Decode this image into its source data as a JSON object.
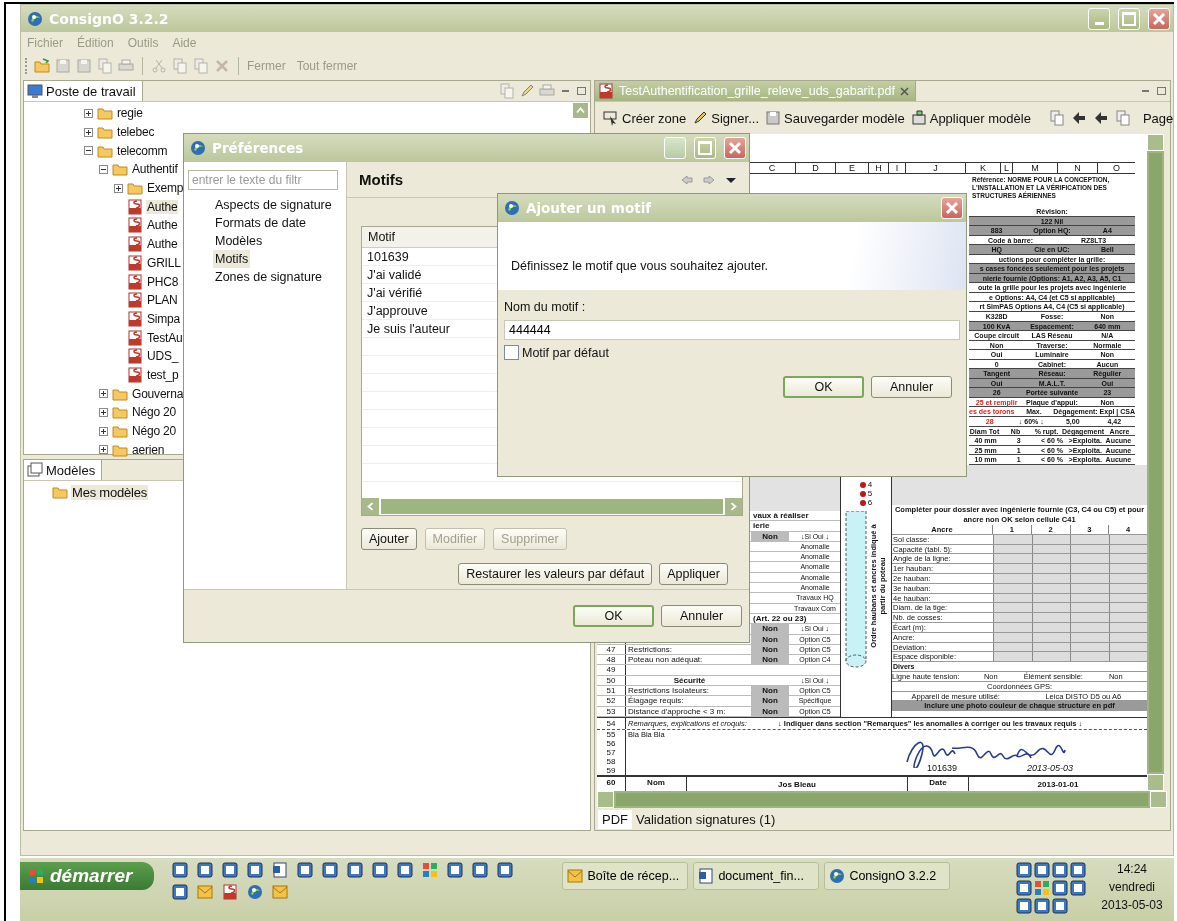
{
  "window": {
    "title": "ConsignO 3.2.2"
  },
  "menu": [
    {
      "label": "Fichier",
      "disabled": true
    },
    {
      "label": "Édition",
      "disabled": true
    },
    {
      "label": "Outils",
      "disabled": true
    },
    {
      "label": "Aide",
      "disabled": true
    }
  ],
  "toolbar": {
    "text_buttons": [
      {
        "label": "Fermer",
        "disabled": true
      },
      {
        "label": "Tout fermer",
        "disabled": true
      }
    ]
  },
  "workspace": {
    "tab": "Poste de travail",
    "tree": [
      {
        "label": "regie",
        "kind": "folder",
        "expanded": false,
        "selected": false
      },
      {
        "label": "telebec",
        "kind": "folder",
        "expanded": false,
        "selected": false
      },
      {
        "label": "telecomm",
        "kind": "folder",
        "expanded": true,
        "selected": false,
        "children": [
          {
            "label": "Authentif",
            "kind": "folder",
            "expanded": true,
            "selected": false,
            "children": [
              {
                "label": "Exemp",
                "kind": "folder",
                "expanded": false,
                "selected": false
              },
              {
                "label": "Authe",
                "kind": "pdf",
                "selected": true
              },
              {
                "label": "Authe",
                "kind": "pdf",
                "selected": false
              },
              {
                "label": "Authe",
                "kind": "pdf",
                "selected": false
              },
              {
                "label": "GRILL",
                "kind": "pdf",
                "selected": false
              },
              {
                "label": "PHC8",
                "kind": "pdf",
                "selected": false
              },
              {
                "label": "PLAN",
                "kind": "pdf",
                "selected": false
              },
              {
                "label": "Simpa",
                "kind": "pdf",
                "selected": false
              },
              {
                "label": "TestAu",
                "kind": "pdf",
                "selected": false
              },
              {
                "label": "UDS_",
                "kind": "pdf",
                "selected": false
              },
              {
                "label": "test_p",
                "kind": "pdf",
                "selected": false
              }
            ]
          },
          {
            "label": "Gouverna",
            "kind": "folder",
            "expanded": false,
            "selected": false
          },
          {
            "label": "Négo 20",
            "kind": "folder",
            "expanded": false,
            "selected": false
          },
          {
            "label": "Négo 20",
            "kind": "folder",
            "expanded": false,
            "selected": false
          },
          {
            "label": "aerien",
            "kind": "folder",
            "expanded": false,
            "selected": false
          }
        ]
      }
    ]
  },
  "models": {
    "tab": "Modèles",
    "tree": [
      {
        "label": "Mes modèles",
        "kind": "folder",
        "selected": true
      }
    ]
  },
  "editor": {
    "tab": "TestAuthentification_grille_releve_uds_gabarit.pdf",
    "toolbar": [
      {
        "label": "Créer zone",
        "kind": "zone"
      },
      {
        "label": "Signer...",
        "kind": "pen"
      },
      {
        "label": "Sauvegarder modèle",
        "kind": "save"
      },
      {
        "label": "Appliquer modèle",
        "kind": "apply"
      }
    ],
    "page_label": "Page",
    "bottom_tabs": [
      {
        "label": "PDF",
        "selected": true
      },
      {
        "label": "Validation signatures (1)",
        "selected": false
      }
    ],
    "pdf": {
      "column_letters": [
        "C",
        "D",
        "E",
        "H",
        "I",
        "J",
        "K",
        "L",
        "M",
        "N",
        "O"
      ],
      "reference": "Référence: NORME POUR LA CONCEPTION, L'INSTALLATION ET LA VÉRIFICATION DES STRUCTURES AÉRIENNES",
      "header_rows": [
        {
          "cells": [
            "Révision:"
          ],
          "dark": false,
          "warning": false
        },
        {
          "cells": [
            "122 Nil"
          ],
          "dark": true,
          "warning": false
        },
        {
          "cells": [
            "883",
            "Option HQ:",
            "A4"
          ],
          "dark": true,
          "warning": false
        },
        {
          "cells": [
            "Code à barre:",
            "RZ8LT3"
          ],
          "dark": false,
          "warning": false
        },
        {
          "cells": [
            "HQ",
            "Cie en UC:",
            "Bell"
          ],
          "dark": true,
          "warning": false
        },
        {
          "cells": [
            "uctions pour compléter la grille:"
          ],
          "dark": false,
          "warning": false
        },
        {
          "cells": [
            "s cases foncées seulement pour les projets"
          ],
          "dark": true,
          "warning": false
        },
        {
          "cells": [
            "nierie fournie (Options: A1, A2, A3, A5, C1"
          ],
          "dark": true,
          "warning": false
        },
        {
          "cells": [
            "oute la grille pour les projets avec ingénierie"
          ],
          "dark": false,
          "warning": false
        },
        {
          "cells": [
            "e Options: A4, C4 (et C5 si applicable)"
          ],
          "dark": false,
          "warning": false
        },
        {
          "cells": [
            "rt SimPAS Options A4, C4 (C5 si applicable)"
          ],
          "dark": false,
          "warning": false
        },
        {
          "cells": [
            "K328D",
            "Fosse:",
            "Non"
          ],
          "dark": false,
          "warning": false
        },
        {
          "cells": [
            "100 KvA",
            "Espacement:",
            "640 mm"
          ],
          "dark": true,
          "warning": false
        },
        {
          "cells": [
            "Coupe circuit",
            "LAS Réseau",
            "N/A"
          ],
          "dark": false,
          "warning": false
        },
        {
          "cells": [
            "Non",
            "Traverse:",
            "Normale"
          ],
          "dark": false,
          "warning": false
        },
        {
          "cells": [
            "Oui",
            "Luminaire",
            "Non"
          ],
          "dark": false,
          "warning": false
        },
        {
          "cells": [
            "0",
            "Cabinet:",
            "Aucun"
          ],
          "dark": false,
          "warning": false
        },
        {
          "cells": [
            "Tangent",
            "Réseau:",
            "Régulier"
          ],
          "dark": true,
          "warning": false
        },
        {
          "cells": [
            "Oui",
            "M.A.L.T.",
            "Oui"
          ],
          "dark": true,
          "warning": false
        },
        {
          "cells": [
            "26",
            "Portée suivante",
            "23"
          ],
          "dark": true,
          "warning": false
        },
        {
          "cells": [
            "25 et remplir",
            "Plaque d'appui:",
            "Non"
          ],
          "dark": false,
          "warning": true
        },
        {
          "cells": [
            "es des torons",
            "Max.",
            "Dégagement: Expl | CSA"
          ],
          "dark": false,
          "warning": true
        },
        {
          "cells": [
            "28",
            "↓ 60% ↓",
            "5,00",
            "4,42"
          ],
          "dark": false,
          "warning": true
        },
        {
          "cells": [
            "Diam Tot",
            "Nb",
            "% rupt.",
            "Dégagement",
            "Ancre"
          ],
          "dark": false,
          "warning": false
        },
        {
          "cells": [
            "40 mm",
            "3",
            "< 60 %",
            ">Exploita.",
            "Aucune"
          ],
          "dark": false,
          "warning": false
        },
        {
          "cells": [
            "25 mm",
            "1",
            "< 60 %",
            ">Exploita.",
            "Aucune"
          ],
          "dark": false,
          "warning": false
        },
        {
          "cells": [
            "10 mm",
            "1",
            "< 60 %",
            ">Exploita.",
            "Aucune"
          ],
          "dark": false,
          "warning": false
        }
      ],
      "markers": [
        "4",
        "5",
        "6"
      ],
      "work_rows": [
        {
          "kind": "heading",
          "text": "vaux à réaliser"
        },
        {
          "kind": "heading",
          "text": "ierie"
        },
        {
          "kind": "row",
          "value": "Non",
          "option": "↓Si Oui ↓"
        },
        {
          "kind": "row",
          "option": "Anomalie"
        },
        {
          "kind": "row",
          "option": "Anomalie"
        },
        {
          "kind": "row",
          "option": "Anomalie"
        },
        {
          "kind": "row",
          "option": "Anomalie"
        },
        {
          "kind": "row",
          "option": "Anomalie"
        },
        {
          "kind": "row",
          "option": "Travaux HQ"
        },
        {
          "kind": "row",
          "option": "Travaux Com"
        },
        {
          "kind": "heading",
          "text": "(Art. 22 ou 23)"
        },
        {
          "kind": "row",
          "value": "Non",
          "option": "↓Si Oui ↓"
        },
        {
          "kind": "row",
          "value": "Non",
          "option": "Option C5"
        },
        {
          "kind": "row",
          "number": "47",
          "label": "Restrictions:",
          "value": "Non",
          "option": "Option C5"
        },
        {
          "kind": "row",
          "number": "48",
          "label": "Poteau non adéquat:",
          "value": "Non",
          "option": "Option C4"
        },
        {
          "kind": "row",
          "number": "49"
        },
        {
          "kind": "row",
          "number": "50",
          "label": "Sécurité",
          "option": "↓Si Oui ↓"
        },
        {
          "kind": "row",
          "number": "51",
          "label": "Restrictions Isolateurs:",
          "value": "Non",
          "option": "Option C5"
        },
        {
          "kind": "row",
          "number": "52",
          "label": "Élagage requis:",
          "value": "Non",
          "option": "Spécifique"
        },
        {
          "kind": "row",
          "number": "53",
          "label": "Distance d'approche < 3 m:",
          "value": "Non",
          "option": "Option C5"
        }
      ],
      "pole_label": "Ordre haubans et ancres indiqué à partir du poteau",
      "anchor_title": "Compléter pour dossier avec ingénierie fournie (C3, C4 ou C5) et pour ancre non OK selon cellule C41",
      "anchor_headers": [
        "Ancre",
        "1",
        "2",
        "3",
        "4"
      ],
      "anchor_rows": [
        "Sol classe:",
        "Capacité (tabl. 5):",
        "Angle de la ligne:",
        "1er hauban:",
        "2e hauban:",
        "3e hauban:",
        "4e hauban:",
        "Diam. de la tige:",
        "Nb. de cosses:",
        "Écart (m):",
        "Ancre:",
        "Déviation:",
        "Espace disponible:"
      ],
      "divers_title": "Divers",
      "divers_rows": [
        {
          "cells": [
            "Ligne haute tension:",
            "Non",
            "Élément sensible:",
            "Non"
          ],
          "dark": false
        },
        {
          "cells": [
            "Coordonnées GPS:"
          ],
          "dark": false
        },
        {
          "cells": [
            "Appareil de mesure utilisé:",
            "Leica DISTO D5 ou A6"
          ],
          "dark": false
        },
        {
          "cells": [
            "Inclure une photo couleur de chaque structure en pdf"
          ],
          "dark": true
        }
      ],
      "remarks": {
        "number": "54",
        "label": "Remarques, explications et croquis:",
        "note": "↓ Indiquer dans section \"Remarques\" les anomalies à corriger ou les travaux requis ↓"
      },
      "notes": [
        {
          "number": "55",
          "text": "Bla Bla Bla"
        },
        {
          "number": "56"
        },
        {
          "number": "57"
        },
        {
          "number": "58"
        },
        {
          "number": "59"
        }
      ],
      "signature": {
        "id": "101639",
        "date": "2013-05-03"
      },
      "footer": {
        "number": "60",
        "cells": [
          "Nom",
          "Jos Bleau",
          "Date",
          "2013-01-01"
        ]
      }
    }
  },
  "preferences": {
    "title": "Préférences",
    "filter_placeholder": "entrer le texte du filtr",
    "nav": [
      {
        "label": "Aspects de signature",
        "selected": false
      },
      {
        "label": "Formats de date",
        "selected": false
      },
      {
        "label": "Modèles",
        "selected": false
      },
      {
        "label": "Motifs",
        "selected": true
      },
      {
        "label": "Zones de signature",
        "selected": false
      }
    ],
    "page_title": "Motifs",
    "table": {
      "columns": [
        "Motif"
      ],
      "rows": [
        "101639",
        "J'ai validé",
        "J'ai vérifié",
        "J'approuve",
        "Je suis l'auteur"
      ]
    },
    "buttons": [
      {
        "label": "Ajouter",
        "disabled": false
      },
      {
        "label": "Modifier",
        "disabled": true
      },
      {
        "label": "Supprimer",
        "disabled": true
      }
    ],
    "page_buttons": [
      {
        "label": "Restaurer les valeurs par défaut"
      },
      {
        "label": "Appliquer"
      }
    ],
    "dialog_buttons": [
      {
        "label": "OK",
        "default": true
      },
      {
        "label": "Annuler",
        "default": false
      }
    ]
  },
  "add_dialog": {
    "title": "Ajouter un motif",
    "message": "Définissez le motif que vous souhaitez ajouter.",
    "field_label": "Nom du motif :",
    "field_value": "444444",
    "checkbox": {
      "label": "Motif par défaut",
      "checked": false
    },
    "buttons": [
      {
        "label": "OK",
        "default": true
      },
      {
        "label": "Annuler",
        "default": false
      }
    ]
  },
  "taskbar": {
    "start": "démarrer",
    "tasks": [
      {
        "label": "Boîte de récep...",
        "selected": false
      },
      {
        "label": "document_fin...",
        "selected": false
      },
      {
        "label": "ConsignO 3.2.2",
        "selected": false
      }
    ],
    "clock": {
      "time": "14:24",
      "day": "vendredi",
      "date": "2013-05-03"
    }
  }
}
